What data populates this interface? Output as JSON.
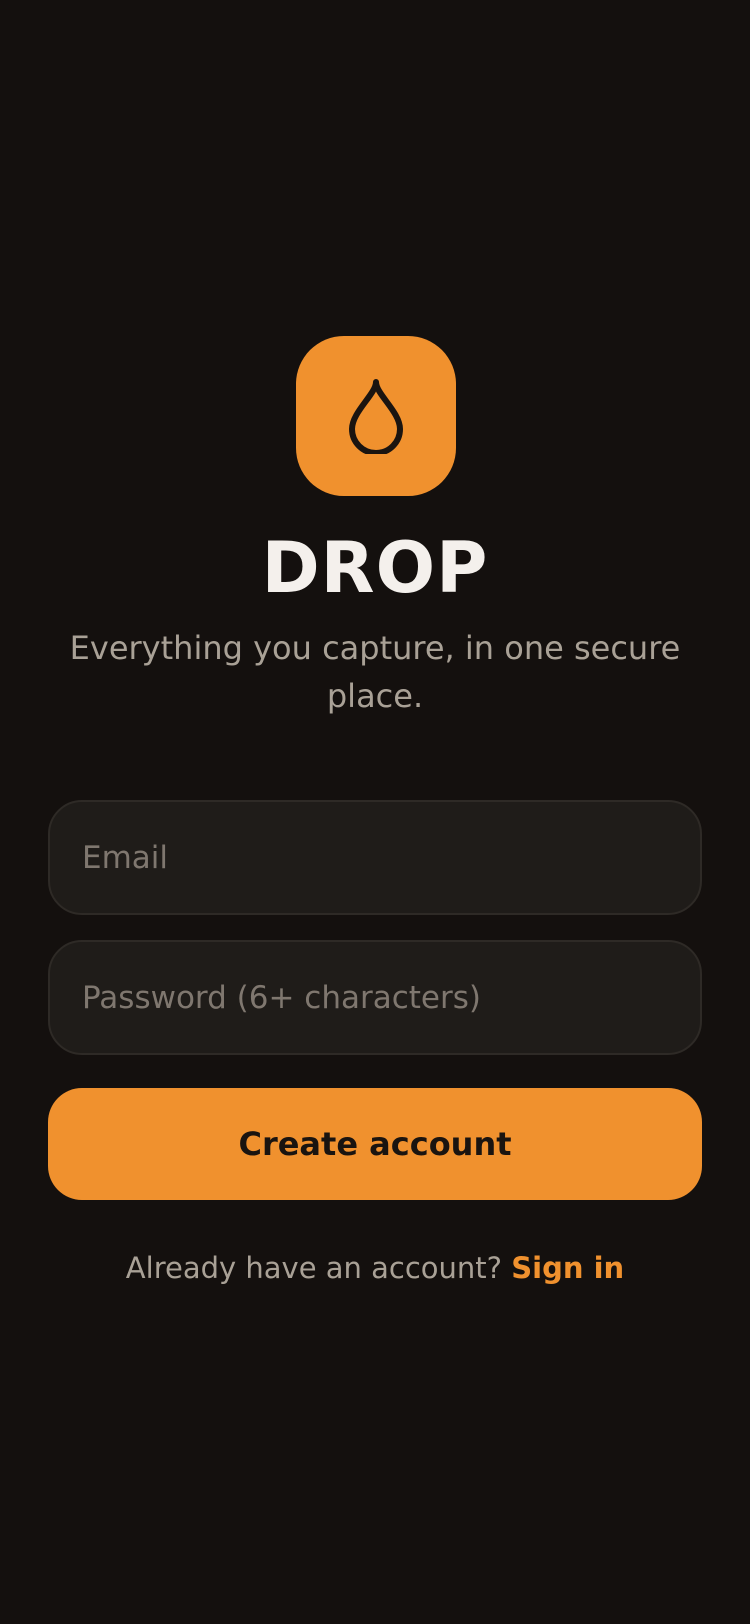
{
  "app": {
    "title": "DROP",
    "tagline": "Everything you capture, in one secure place.",
    "logo_icon": "drop-icon"
  },
  "form": {
    "email_placeholder": "Email",
    "email_value": "",
    "password_placeholder": "Password (6+ characters)",
    "password_value": "",
    "submit_label": "Create account"
  },
  "footer": {
    "prompt_text": "Already have an account?",
    "signin_label": "Sign in"
  },
  "colors": {
    "background": "#14100e",
    "accent": "#f0912e",
    "field_background": "#1f1c19",
    "text_primary": "#f4f0ec",
    "text_secondary": "#a9a196"
  }
}
